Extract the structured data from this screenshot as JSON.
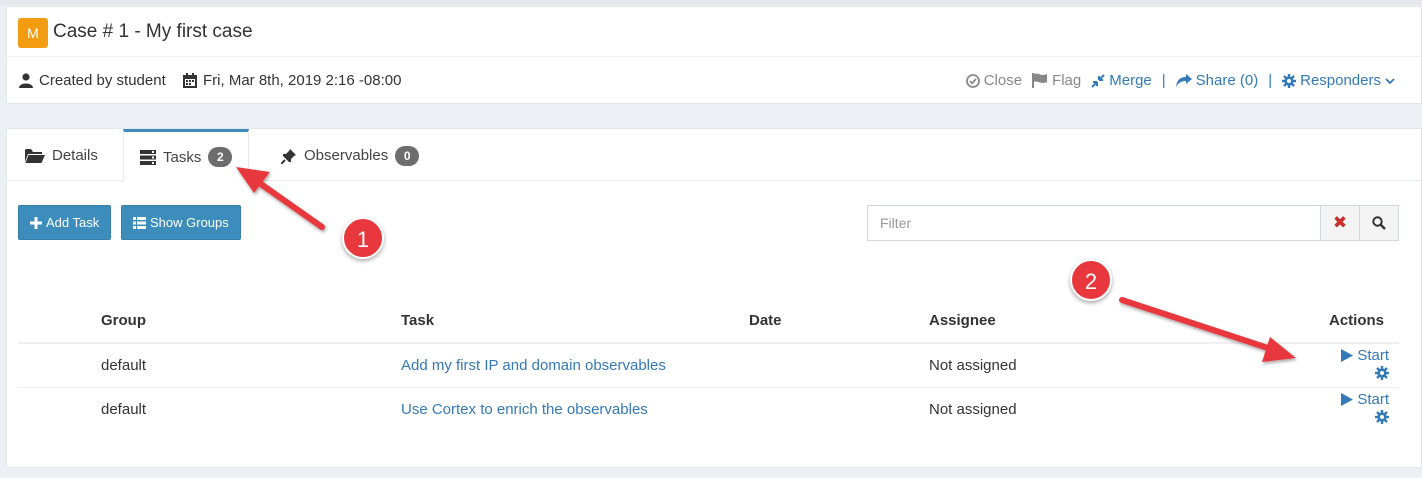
{
  "case": {
    "severity_letter": "M",
    "title": "Case # 1 - My first case",
    "created_by": "Created by student",
    "date": "Fri, Mar 8th, 2019 2:16 -08:00",
    "actions": {
      "close": "Close",
      "flag": "Flag",
      "merge": "Merge",
      "share": "Share (0)",
      "responders": "Responders",
      "separator": "|"
    }
  },
  "tabs": [
    {
      "label": "Details"
    },
    {
      "label": "Tasks",
      "count": "2"
    },
    {
      "label": "Observables",
      "count": "0"
    }
  ],
  "toolbar": {
    "add_task": "Add Task",
    "show_groups": "Show Groups",
    "filter_placeholder": "Filter"
  },
  "table": {
    "headers": {
      "group": "Group",
      "task": "Task",
      "date": "Date",
      "assignee": "Assignee",
      "actions": "Actions"
    },
    "rows": [
      {
        "group": "default",
        "task": "Add my first IP and domain observables",
        "date": "",
        "assignee": "Not assigned",
        "action": "Start"
      },
      {
        "group": "default",
        "task": "Use Cortex to enrich the observables",
        "date": "",
        "assignee": "Not assigned",
        "action": "Start"
      }
    ]
  },
  "annotations": [
    "1",
    "2"
  ],
  "colors": {
    "accent": "#3c8dbc",
    "link": "#337ab7",
    "severity": "#f39c12",
    "annotation": "#e8383d"
  }
}
